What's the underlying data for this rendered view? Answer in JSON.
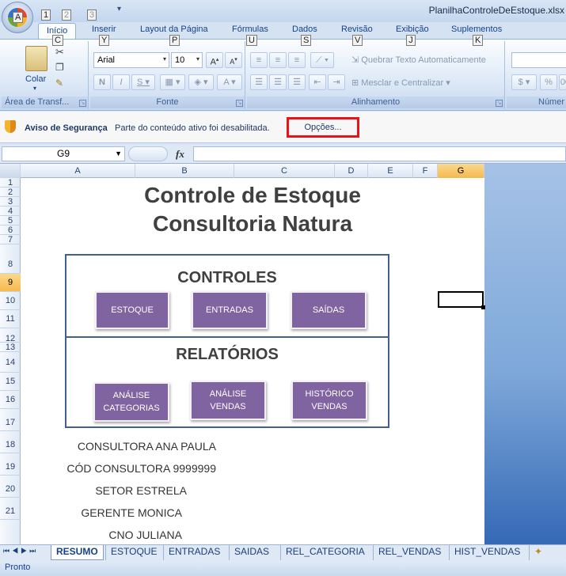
{
  "window": {
    "doc_title": "PlanilhaControleDeEstoque.xlsx"
  },
  "qat": {
    "keytips": [
      "1",
      "2",
      "3"
    ],
    "office_keytip": "A"
  },
  "ribbon_tabs": [
    {
      "label": "Início",
      "keytip": "C"
    },
    {
      "label": "Inserir",
      "keytip": "Y"
    },
    {
      "label": "Layout da Página",
      "keytip": "P"
    },
    {
      "label": "Fórmulas",
      "keytip": "U"
    },
    {
      "label": "Dados",
      "keytip": "S"
    },
    {
      "label": "Revisão",
      "keytip": "V"
    },
    {
      "label": "Exibição",
      "keytip": "J"
    },
    {
      "label": "Suplementos",
      "keytip": "K"
    }
  ],
  "ribbon": {
    "clipboard": {
      "label": "Área de Transf...",
      "paste_label": "Colar"
    },
    "font": {
      "label": "Fonte",
      "font_name": "Arial",
      "font_size": "10"
    },
    "alignment": {
      "label": "Alinhamento",
      "wrap_text": "Quebrar Texto Automaticamente",
      "merge_center": "Mesclar e Centralizar"
    },
    "number": {
      "label": "Númer"
    }
  },
  "security": {
    "label": "Aviso de Segurança",
    "message": "Parte do conteúdo ativo foi desabilitada.",
    "options_button": "Opções..."
  },
  "formula_bar": {
    "name_box": "G9",
    "fx": "fx"
  },
  "columns": [
    "A",
    "B",
    "C",
    "D",
    "E",
    "F",
    "G"
  ],
  "rows": [
    "1",
    "2",
    "3",
    "4",
    "5",
    "6",
    "7",
    "8",
    "9",
    "10",
    "11",
    "12",
    "13",
    "14",
    "15",
    "16",
    "17",
    "18",
    "19",
    "20",
    "21"
  ],
  "sheet": {
    "title_line1": "Controle de Estoque",
    "title_line2": "Consultoria Natura",
    "controls_title": "CONTROLES",
    "reports_title": "RELATÓRIOS",
    "buttons": {
      "estoque": "ESTOQUE",
      "entradas": "ENTRADAS",
      "saidas": "SAÍDAS",
      "analise_categorias_1": "ANÁLISE",
      "analise_categorias_2": "CATEGORIAS",
      "analise_vendas_1": "ANÁLISE",
      "analise_vendas_2": "VENDAS",
      "historico_vendas_1": "HISTÓRICO",
      "historico_vendas_2": "VENDAS"
    },
    "info": [
      {
        "label": "CONSULTORA",
        "value": "ANA PAULA"
      },
      {
        "label": "CÓD CONSULTORA",
        "value": "9999999"
      },
      {
        "label": "SETOR",
        "value": "ESTRELA"
      },
      {
        "label": "GERENTE",
        "value": "MONICA"
      },
      {
        "label": "CNO",
        "value": "JULIANA"
      }
    ]
  },
  "sheet_tabs": [
    "RESUMO",
    "ESTOQUE",
    "ENTRADAS",
    "SAIDAS",
    "REL_CATEGORIA",
    "REL_VENDAS",
    "HIST_VENDAS"
  ],
  "status": {
    "text": "Pronto"
  }
}
